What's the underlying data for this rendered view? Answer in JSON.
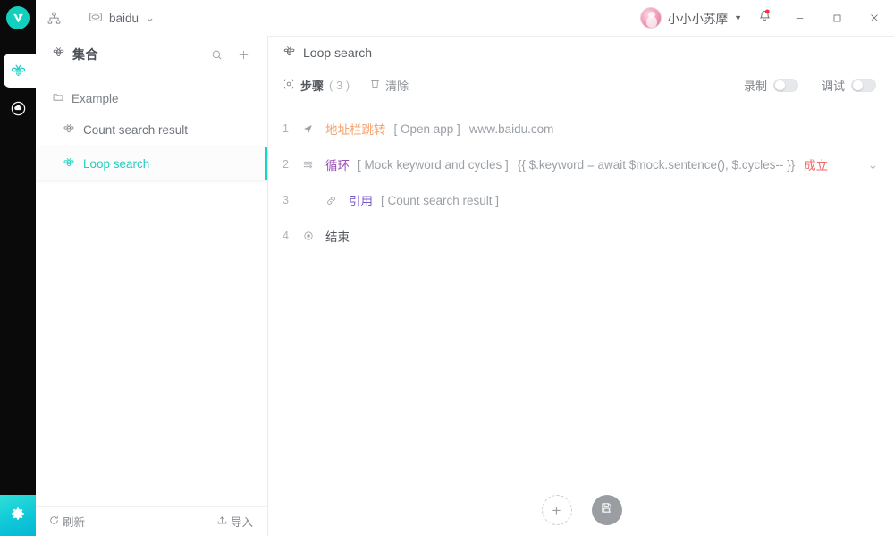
{
  "window": {
    "app_logo": "v-logo-icon",
    "minimize_label": "–",
    "maximize_label": "□",
    "close_label": "✕"
  },
  "titlebar": {
    "sitemap_icon": "sitemap-icon",
    "tab": {
      "icon": "browser-icon",
      "label": "baidu",
      "caret": "⌄"
    },
    "user": {
      "name": "小小小苏摩",
      "caret": "▼",
      "avatar_icon": "avatar"
    },
    "bell_icon": "bell-icon",
    "bell_badge": "●"
  },
  "rail": {
    "items": [
      {
        "icon": "bee-icon",
        "active": true
      },
      {
        "icon": "cloud-icon",
        "active": false
      }
    ],
    "settings_icon": "gear-icon"
  },
  "sidebar": {
    "header": {
      "icon": "bee-icon",
      "title": "集合",
      "search_icon": "search-icon",
      "add_icon": "plus-icon"
    },
    "group": {
      "icon": "folder-icon",
      "label": "Example"
    },
    "items": [
      {
        "icon": "bee-icon",
        "label": "Count search result",
        "active": false
      },
      {
        "icon": "bee-icon",
        "label": "Loop search",
        "active": true
      }
    ],
    "footer": {
      "refresh_icon": "refresh-icon",
      "refresh_label": "刷新",
      "import_icon": "import-icon",
      "import_label": "导入"
    }
  },
  "main": {
    "title": {
      "icon": "bee-icon",
      "text": "Loop search"
    },
    "toolbar": {
      "steps_icon": "steps-icon",
      "steps_label": "步骤",
      "steps_count": "( 3 )",
      "clear_icon": "trash-icon",
      "clear_label": "清除",
      "record_label": "录制",
      "record_on": false,
      "debug_label": "调试",
      "debug_on": false
    },
    "steps": [
      {
        "num": "1",
        "icon": "cursor-arrow-icon",
        "label": "地址栏跳转",
        "label_color": "orange",
        "bracket": "[ Open app ]",
        "extra": "www.baidu.com",
        "condition": "",
        "chevron": "",
        "indent": false
      },
      {
        "num": "2",
        "icon": "loop-icon",
        "label": "循环",
        "label_color": "purple",
        "bracket": "[ Mock keyword and cycles ]",
        "extra": "{{ $.keyword = await $mock.sentence(), $.cycles-- }}",
        "condition": "成立",
        "chevron": "⌄",
        "indent": false
      },
      {
        "num": "3",
        "icon": "link-icon",
        "label": "引用",
        "label_color": "violet",
        "bracket": "[ Count search result ]",
        "extra": "",
        "condition": "",
        "chevron": "",
        "indent": true
      },
      {
        "num": "4",
        "icon": "stop-icon",
        "label": "结束",
        "label_color": "gray",
        "bracket": "",
        "extra": "",
        "condition": "",
        "chevron": "",
        "indent": false
      }
    ],
    "fab": {
      "add_icon": "plus-icon",
      "add_label": "+",
      "save_icon": "save-icon"
    }
  },
  "colors": {
    "accent_teal": "#19d4c3",
    "orange": "#f4a16b",
    "purple": "#9b4fb5",
    "violet": "#7a5ac9",
    "red": "#f06a6a",
    "rail_dark": "#0a0a0a"
  }
}
